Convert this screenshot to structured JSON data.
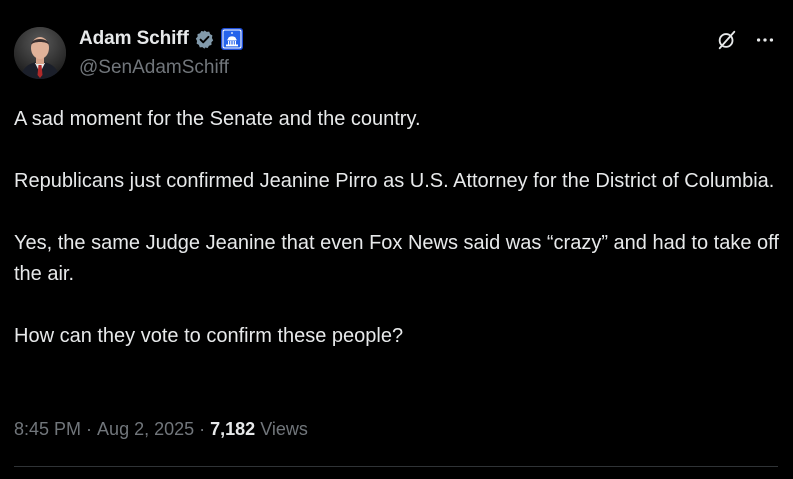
{
  "author": {
    "display_name": "Adam Schiff",
    "handle": "@SenAdamSchiff",
    "verified_badge_color": "#829aab",
    "affiliation_badge_icon": "capitol-dome-icon",
    "affiliation_badge_color": "#1d4ed8"
  },
  "tweet": {
    "paragraphs": [
      "A sad moment for the Senate and the country.",
      "Republicans just confirmed Jeanine Pirro as U.S. Attorney for the District of Columbia.",
      "Yes, the same Judge Jeanine that even Fox News said was “crazy” and had to take off the air.",
      "How can they vote to confirm these people?"
    ]
  },
  "meta": {
    "time": "8:45 PM",
    "separator": "·",
    "date": "Aug 2, 2025",
    "views_count": "7,182",
    "views_label": "Views"
  },
  "icons": {
    "grok": "grok-icon",
    "more": "more-icon"
  },
  "colors": {
    "background": "#000000",
    "text_primary": "#e7e9ea",
    "text_secondary": "#71767b",
    "divider": "#2f3336"
  }
}
